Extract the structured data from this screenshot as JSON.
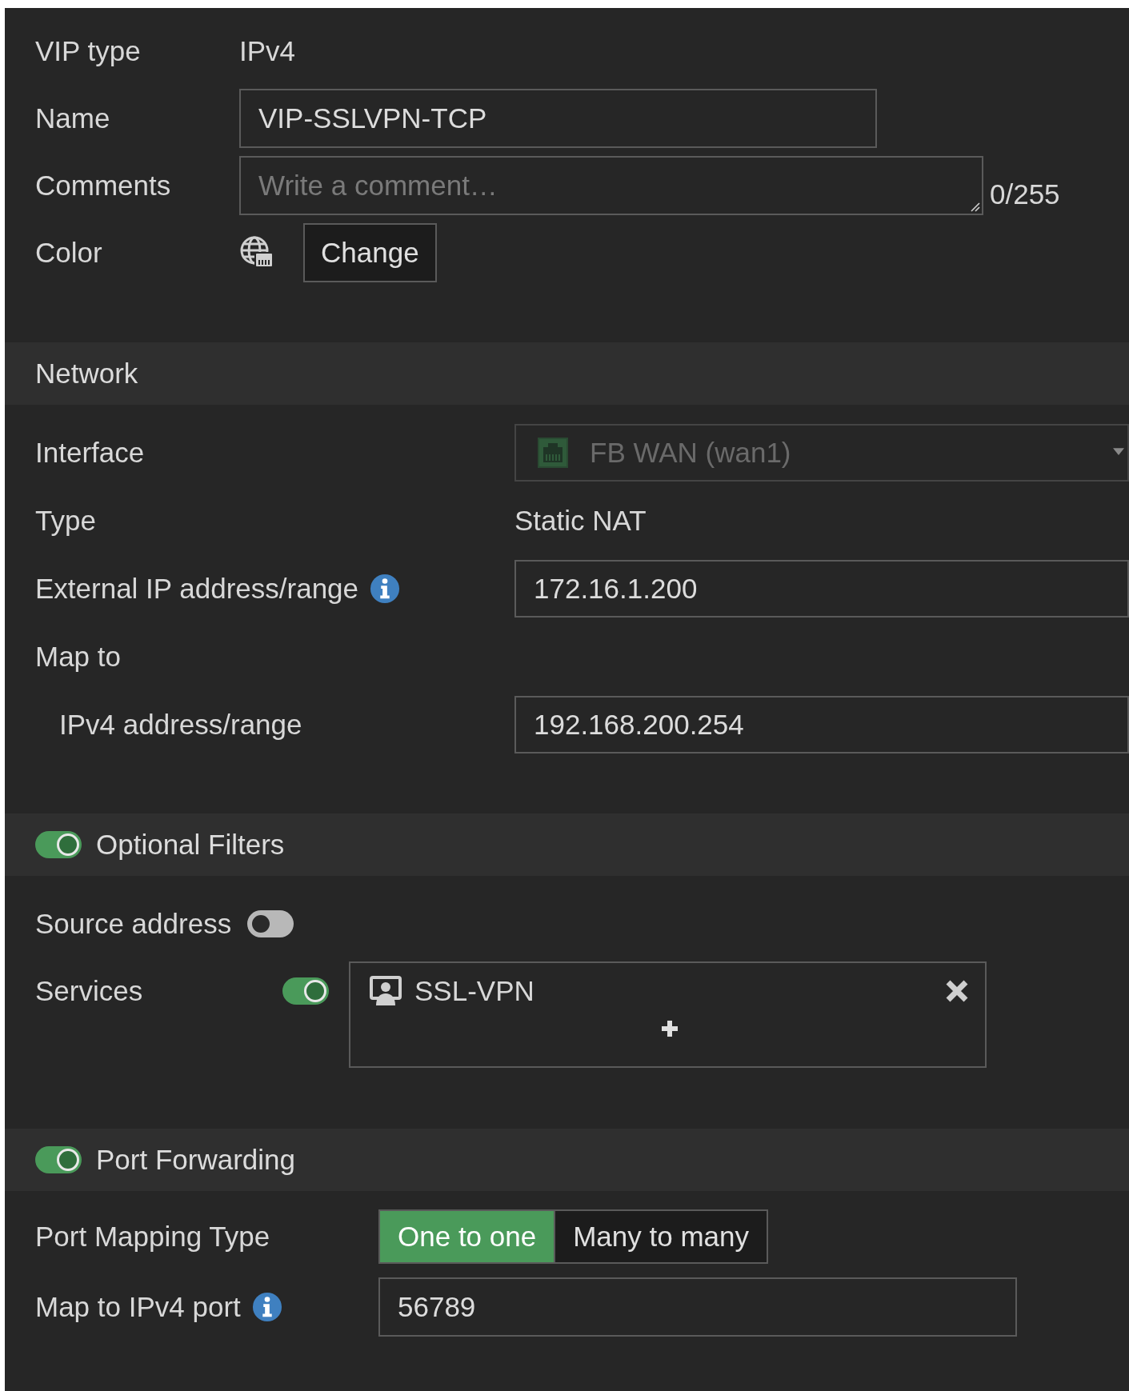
{
  "general": {
    "vip_type": {
      "label": "VIP type",
      "value": "IPv4"
    },
    "name": {
      "label": "Name",
      "value": "VIP-SSLVPN-TCP"
    },
    "comments": {
      "label": "Comments",
      "placeholder": "Write a comment…",
      "counter": "0/255"
    },
    "color": {
      "label": "Color",
      "button": "Change"
    }
  },
  "network": {
    "title": "Network",
    "interface": {
      "label": "Interface",
      "value": "FB WAN (wan1)",
      "disabled": true
    },
    "type": {
      "label": "Type",
      "value": "Static NAT"
    },
    "external_ip": {
      "label": "External IP address/range",
      "value": "172.16.1.200"
    },
    "map_to": {
      "label": "Map to"
    },
    "ipv4_range": {
      "label": "IPv4 address/range",
      "value": "192.168.200.254"
    }
  },
  "optional_filters": {
    "title": "Optional Filters",
    "on": true,
    "source_address": {
      "label": "Source address",
      "on": false
    },
    "services": {
      "label": "Services",
      "on": true,
      "items": [
        {
          "name": "SSL-VPN"
        }
      ]
    }
  },
  "port_forwarding": {
    "title": "Port Forwarding",
    "on": true,
    "mapping_type": {
      "label": "Port Mapping Type",
      "options": [
        {
          "label": "One to one",
          "selected": true
        },
        {
          "label": "Many to many",
          "selected": false
        }
      ]
    },
    "port": {
      "label": "Map to IPv4 port",
      "value": "56789"
    }
  }
}
